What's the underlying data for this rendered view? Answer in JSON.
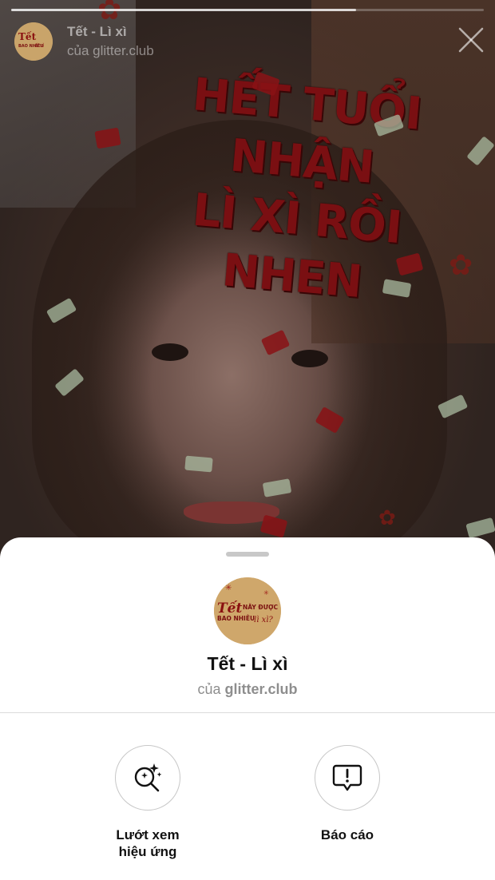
{
  "header": {
    "effect_name": "Tết - Lì xì",
    "by_line": "của glitter.club",
    "progress_fraction": 0.73
  },
  "effect_overlay": {
    "text": "HẾT TUỔI NHẬN\nLÌ XÌ RỒI NHEN"
  },
  "avatar": {
    "line1": "Tết",
    "line2": "NĂY ĐƯỢC",
    "line3": "BAO NHIÊU",
    "line4": "lì xì?"
  },
  "sheet": {
    "title": "Tết - Lì xì",
    "by_prefix": "của",
    "creator": "glitter.club"
  },
  "actions": {
    "browse_label": "Lướt xem\nhiệu ứng",
    "report_label": "Báo cáo"
  },
  "colors": {
    "sheet_bg": "#ffffff",
    "effect_text": "#7a0f12",
    "avatar_bg": "#cfa76b"
  }
}
